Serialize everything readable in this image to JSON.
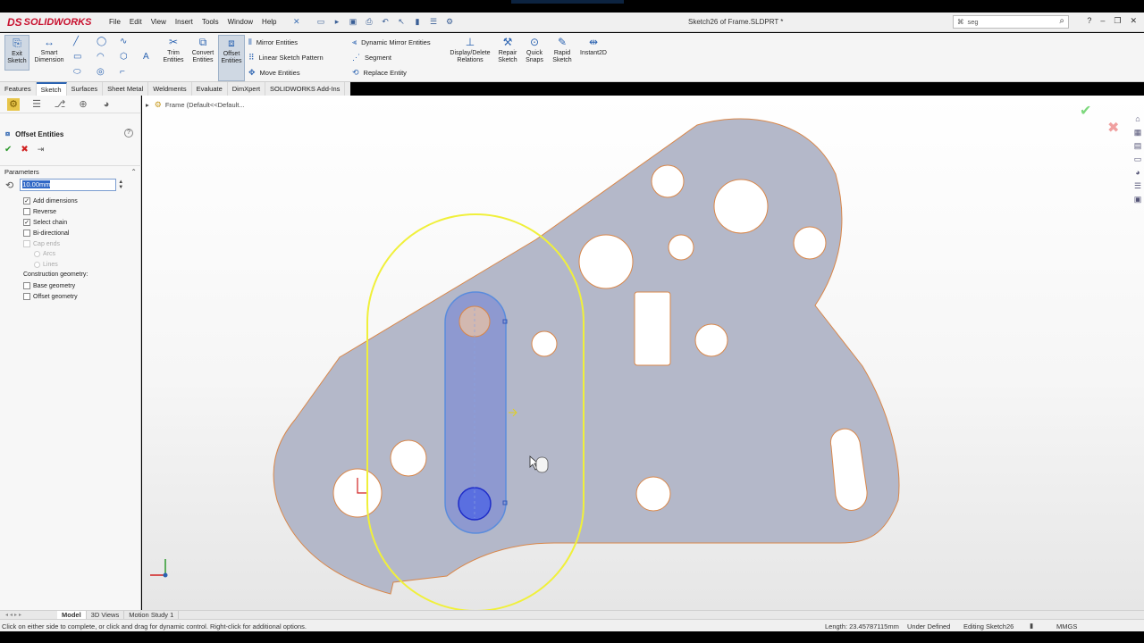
{
  "app": {
    "name": "SOLIDWORKS",
    "doc_title": "Sketch26 of Frame.SLDPRT *"
  },
  "menu": [
    "File",
    "Edit",
    "View",
    "Insert",
    "Tools",
    "Window",
    "Help"
  ],
  "search": {
    "value": "seg"
  },
  "ribbon": {
    "exit_sketch": "Exit Sketch",
    "smart_dimension": "Smart Dimension",
    "trim_entities": "Trim Entities",
    "convert_entities": "Convert Entities",
    "offset_entities": "Offset Entities",
    "mirror_entities": "Mirror Entities",
    "linear_sketch_pattern": "Linear Sketch Pattern",
    "move_entities": "Move Entities",
    "dynamic_mirror": "Dynamic Mirror Entities",
    "segment": "Segment",
    "replace_entity": "Replace Entity",
    "display_delete_relations": "Display/Delete Relations",
    "repair_sketch": "Repair Sketch",
    "quick_snaps": "Quick Snaps",
    "rapid_sketch": "Rapid Sketch",
    "instant2d": "Instant2D"
  },
  "cmd_tabs": [
    "Features",
    "Sketch",
    "Surfaces",
    "Sheet Metal",
    "Weldments",
    "Evaluate",
    "DimXpert",
    "SOLIDWORKS Add-Ins"
  ],
  "property_manager": {
    "title": "Offset Entities",
    "section": "Parameters",
    "distance": "10.00mm",
    "options": [
      {
        "label": "Add dimensions",
        "checked": true
      },
      {
        "label": "Reverse",
        "checked": false
      },
      {
        "label": "Select chain",
        "checked": true
      },
      {
        "label": "Bi-directional",
        "checked": false
      },
      {
        "label": "Cap ends",
        "checked": false,
        "disabled": true
      }
    ],
    "cap_options": [
      "Arcs",
      "Lines"
    ],
    "construction_label": "Construction geometry:",
    "construction_options": [
      {
        "label": "Base geometry",
        "checked": false
      },
      {
        "label": "Offset geometry",
        "checked": false
      }
    ]
  },
  "tree": {
    "label": "Frame  (Default<<Default..."
  },
  "bottom_tabs": [
    "Model",
    "3D Views",
    "Motion Study 1"
  ],
  "status": {
    "message": "Click on either side to complete, or click and drag for dynamic control.  Right-click for additional options.",
    "length": "Length: 23.45787115mm",
    "definition": "Under Defined",
    "editing": "Editing Sketch26",
    "units": "MMGS"
  },
  "colors": {
    "accent": "#2b63b1",
    "part_fill": "#b4b8c9",
    "edge": "#d9874a",
    "offset_preview": "#f0f03a",
    "selected": "#4a6fd8"
  }
}
